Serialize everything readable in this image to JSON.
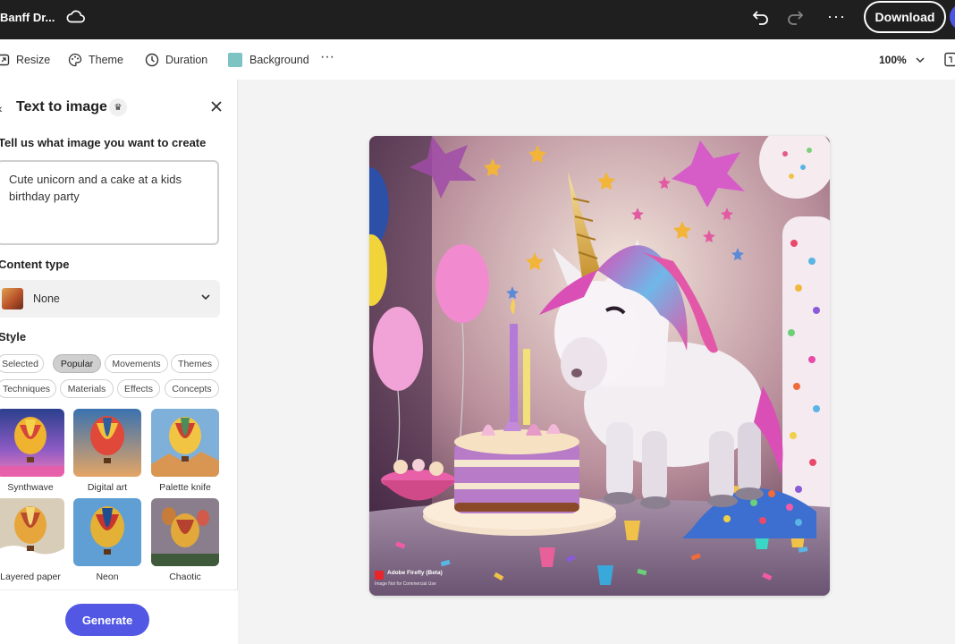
{
  "topbar": {
    "doc_title": "Banff Dr...",
    "download_label": "Download",
    "more_label": "···"
  },
  "toolbar": {
    "resize": "Resize",
    "theme": "Theme",
    "duration": "Duration",
    "background": "Background",
    "background_color": "#7ec3c4",
    "more": "···",
    "zoom": "100%"
  },
  "panel": {
    "back": "‹",
    "title": "Text to image",
    "prompt_label": "Tell us what image you want to create",
    "prompt_value": "Cute unicorn and a cake at a kids birthday party",
    "content_type_label": "Content type",
    "content_type_value": "None",
    "style_label": "Style",
    "chips_row1": [
      "Selected",
      "Popular",
      "Movements",
      "Themes"
    ],
    "chips_row2": [
      "Techniques",
      "Materials",
      "Effects",
      "Concepts"
    ],
    "active_chip": "Popular",
    "styles": [
      "Synthwave",
      "Digital art",
      "Palette knife",
      "Layered paper",
      "Neon",
      "Chaotic"
    ],
    "generate_label": "Generate",
    "accent_color": "#5258e4"
  },
  "canvas": {
    "watermark_title": "Adobe Firefly (Beta)",
    "watermark_sub": "Image Not for Commercial Use"
  }
}
